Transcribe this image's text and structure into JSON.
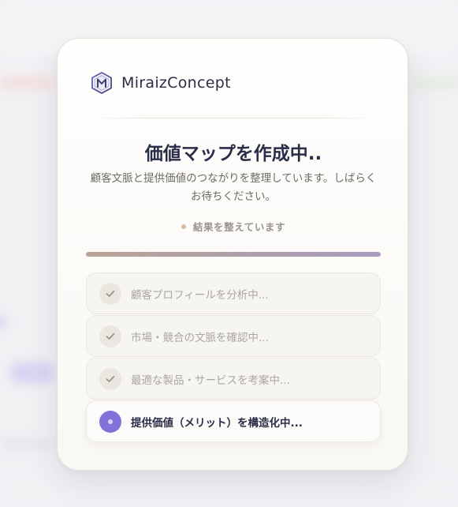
{
  "brand": {
    "name": "MiraizConcept",
    "logo_icon": "hexagon-m-logo-icon"
  },
  "dialog": {
    "title": "価値マップを作成中..",
    "description": "顧客文脈と提供価値のつながりを整理しています。しばらくお待ちください。",
    "status_text": "結果を整えています",
    "progress": 1.0
  },
  "steps": [
    {
      "label": "顧客プロフィールを分析中...",
      "state": "done",
      "icon": "check-icon"
    },
    {
      "label": "市場・競合の文脈を確認中...",
      "state": "done",
      "icon": "check-icon"
    },
    {
      "label": "最適な製品・サービスを考案中...",
      "state": "done",
      "icon": "check-icon"
    },
    {
      "label": "提供価値（メリット）を構造化中...",
      "state": "active",
      "icon": "dot-icon"
    }
  ],
  "colors": {
    "accent": "#8072d8",
    "title": "#2a2d48",
    "status_dot": "#d7b8a4"
  }
}
